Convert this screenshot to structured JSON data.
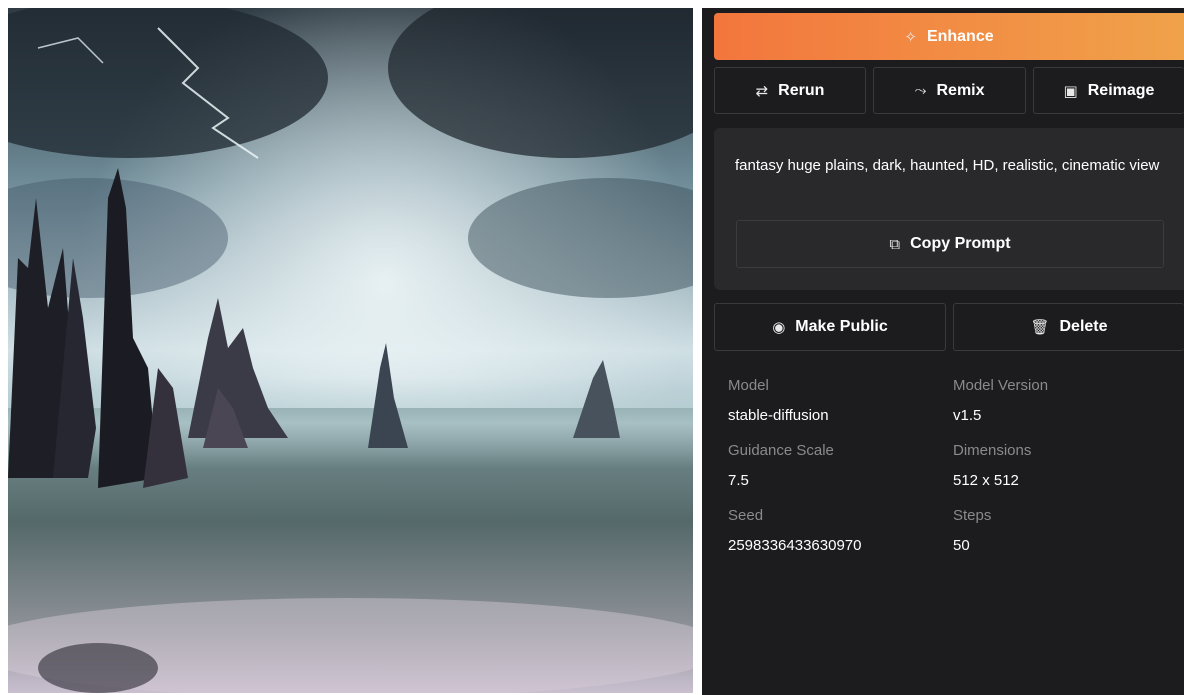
{
  "actions": {
    "enhance_label": "Enhance",
    "rerun_label": "Rerun",
    "remix_label": "Remix",
    "reimage_label": "Reimage",
    "copy_prompt_label": "Copy Prompt",
    "make_public_label": "Make Public",
    "delete_label": "Delete"
  },
  "prompt": {
    "text": "fantasy huge plains, dark, haunted, HD, realistic, cinematic view"
  },
  "details": {
    "model_label": "Model",
    "model_value": "stable-diffusion",
    "model_version_label": "Model Version",
    "model_version_value": "v1.5",
    "guidance_label": "Guidance Scale",
    "guidance_value": "7.5",
    "dimensions_label": "Dimensions",
    "dimensions_value": "512 x 512",
    "seed_label": "Seed",
    "seed_value": "2598336433630970",
    "steps_label": "Steps",
    "steps_value": "50"
  },
  "icons": {
    "enhance": "magic-wand-icon",
    "rerun": "repeat-icon",
    "remix": "shuffle-icon",
    "reimage": "image-icon",
    "copy": "copy-icon",
    "public": "eye-icon",
    "delete": "trash-icon"
  },
  "colors": {
    "accent_start": "#f3763d",
    "accent_end": "#f0a24a",
    "panel_bg": "#1c1c1e",
    "card_bg": "#29292c"
  }
}
